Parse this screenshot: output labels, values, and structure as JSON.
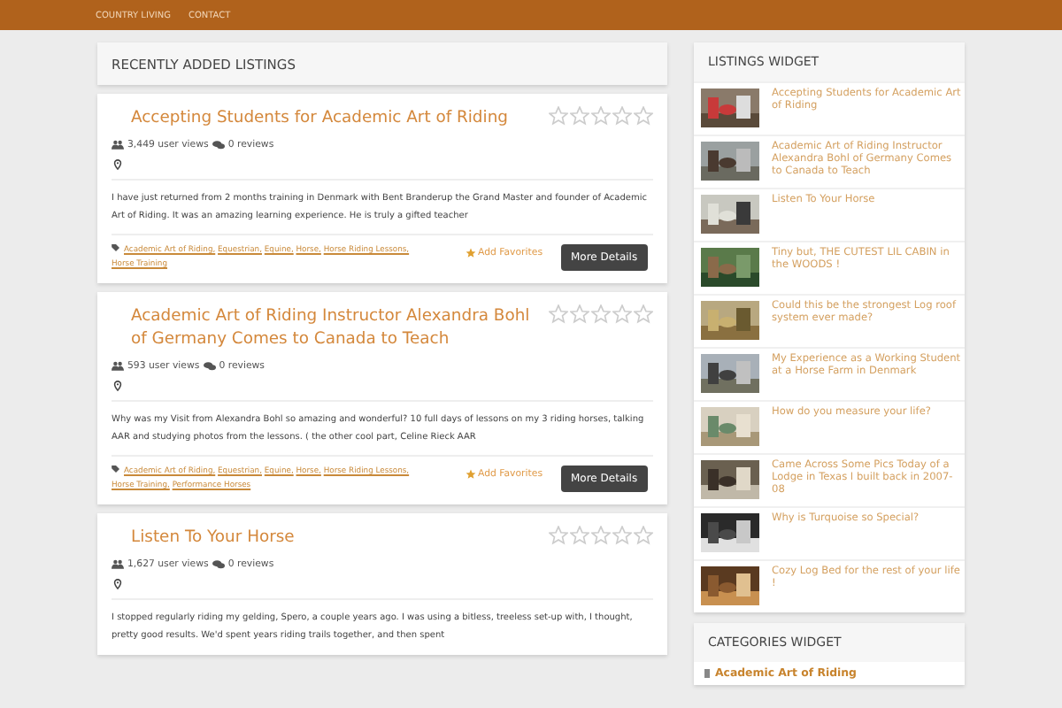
{
  "nav": [
    {
      "label": "COUNTRY LIVING"
    },
    {
      "label": "CONTACT"
    }
  ],
  "main": {
    "heading": "RECENTLY ADDED LISTINGS",
    "listings": [
      {
        "title": "Accepting Students for Academic Art of Riding",
        "stars": 0,
        "views": "3,449 user views",
        "reviews": "0 reviews",
        "description": "I have just returned from 2 months training in Denmark with Bent Branderup the Grand Master and founder of Academic Art of Riding.  It was an amazing learning experience. He is truly a gifted teacher",
        "tags": [
          "Academic Art of Riding,",
          "Equestrian,",
          "Equine,",
          "Horse,",
          "Horse Riding Lessons,",
          "Horse Training"
        ],
        "favorite": "Add Favorites",
        "button": "More Details"
      },
      {
        "title": "Academic Art of Riding Instructor  Alexandra Bohl of Germany Comes to Canada to Teach",
        "stars": 0,
        "views": "593 user views",
        "reviews": "0 reviews",
        "description": "Why was my Visit from Alexandra Bohl so amazing and wonderful? 10 full days of lessons on my 3 riding horses, talking AAR and studying photos from the lessons. ( the other cool part, Celine Rieck AAR",
        "tags": [
          "Academic Art of Riding,",
          "Equestrian,",
          "Equine,",
          "Horse,",
          "Horse Riding Lessons,",
          "Horse Training,",
          "Performance Horses"
        ],
        "favorite": "Add Favorites",
        "button": "More Details"
      },
      {
        "title": "Listen To Your Horse",
        "stars": 0,
        "views": "1,627 user views",
        "reviews": "0 reviews",
        "description": "I stopped regularly riding my gelding, Spero, a couple years ago. I was using a bitless, treeless set-up with, I thought, pretty good results. We'd spent years riding trails together, and then spent"
      }
    ]
  },
  "listings_widget": {
    "heading": "LISTINGS WIDGET",
    "items": [
      {
        "title": "Accepting Students for Academic Art of Riding"
      },
      {
        "title": "Academic Art of Riding Instructor  Alexandra Bohl of Germany Comes to Canada to Teach"
      },
      {
        "title": "Listen To Your Horse"
      },
      {
        "title": "Tiny but, THE CUTEST LIL CABIN in the WOODS !"
      },
      {
        "title": "Could this be the strongest Log roof system ever made?"
      },
      {
        "title": "My Experience as a Working Student at a Horse Farm in Denmark"
      },
      {
        "title": "How do you measure your life?"
      },
      {
        "title": "Came Across Some Pics Today of a Lodge in Texas I built back in 2007- 08"
      },
      {
        "title": "Why is Turquoise so Special?"
      },
      {
        "title": "Cozy Log Bed for the rest of your life !"
      }
    ]
  },
  "categories_widget": {
    "heading": "CATEGORIES WIDGET",
    "items": [
      {
        "label": "Academic Art of Riding"
      }
    ]
  }
}
